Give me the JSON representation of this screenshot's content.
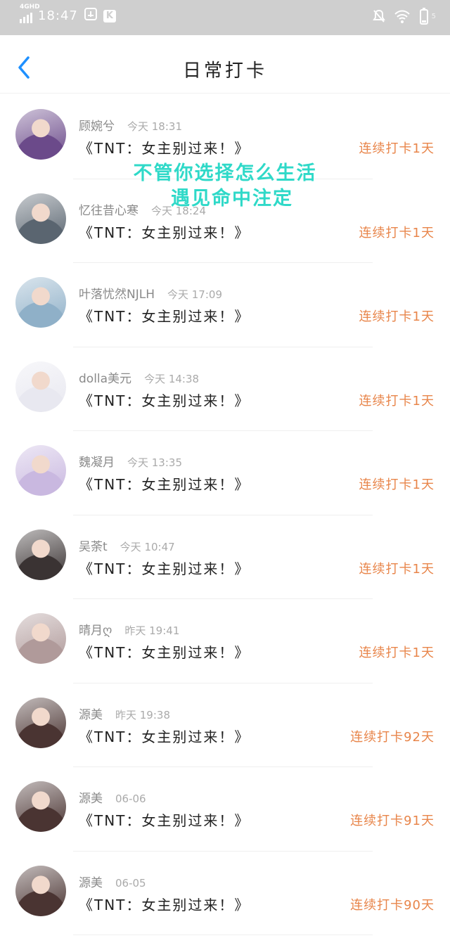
{
  "status_bar": {
    "network": "4GHD",
    "time": "18:47",
    "badges": [
      "lock-icon",
      "k-app-icon"
    ],
    "k_label": "K",
    "icons": [
      "mute-bell-icon",
      "wifi-icon",
      "battery-icon"
    ],
    "battery": "5"
  },
  "header": {
    "back_icon": "chevron-left-icon",
    "title": "日常打卡"
  },
  "overlay_text": {
    "line1": "不管你选择怎么生活",
    "line2": "遇见命中注定"
  },
  "colors": {
    "accent": "#1e90ff",
    "streak": "#e8854a",
    "overlay": "#2fd9c8",
    "status_bg": "#cfcfcf"
  },
  "checkins": [
    {
      "name": "顾婉兮",
      "time": "今天 18:31",
      "book": "《TNT：女主别过来！》",
      "streak": "连续打卡1天",
      "avatar_color": "#6b4a8a"
    },
    {
      "name": "忆往昔心寒",
      "time": "今天 18:24",
      "book": "《TNT：女主别过来！》",
      "streak": "连续打卡1天",
      "avatar_color": "#5a6570"
    },
    {
      "name": "叶落忧然NJLH",
      "time": "今天 17:09",
      "book": "《TNT：女主别过来！》",
      "streak": "连续打卡1天",
      "avatar_color": "#8fb0c8"
    },
    {
      "name": "dolla美元",
      "time": "今天 14:38",
      "book": "《TNT：女主别过来！》",
      "streak": "连续打卡1天",
      "avatar_color": "#e8e8f0"
    },
    {
      "name": "魏凝月",
      "time": "今天 13:35",
      "book": "《TNT：女主别过来！》",
      "streak": "连续打卡1天",
      "avatar_color": "#c9b8e0"
    },
    {
      "name": "吴荼t",
      "time": "今天 10:47",
      "book": "《TNT：女主别过来！》",
      "streak": "连续打卡1天",
      "avatar_color": "#3a3333"
    },
    {
      "name": "晴月ღ",
      "time": "昨天 19:41",
      "book": "《TNT：女主别过来！》",
      "streak": "连续打卡1天",
      "avatar_color": "#b09a9a"
    },
    {
      "name": "源美",
      "time": "昨天 19:38",
      "book": "《TNT：女主别过来！》",
      "streak": "连续打卡92天",
      "avatar_color": "#4a3432"
    },
    {
      "name": "源美",
      "time": "06-06",
      "book": "《TNT：女主别过来！》",
      "streak": "连续打卡91天",
      "avatar_color": "#4a3432"
    },
    {
      "name": "源美",
      "time": "06-05",
      "book": "《TNT：女主别过来！》",
      "streak": "连续打卡90天",
      "avatar_color": "#4a3432"
    }
  ]
}
